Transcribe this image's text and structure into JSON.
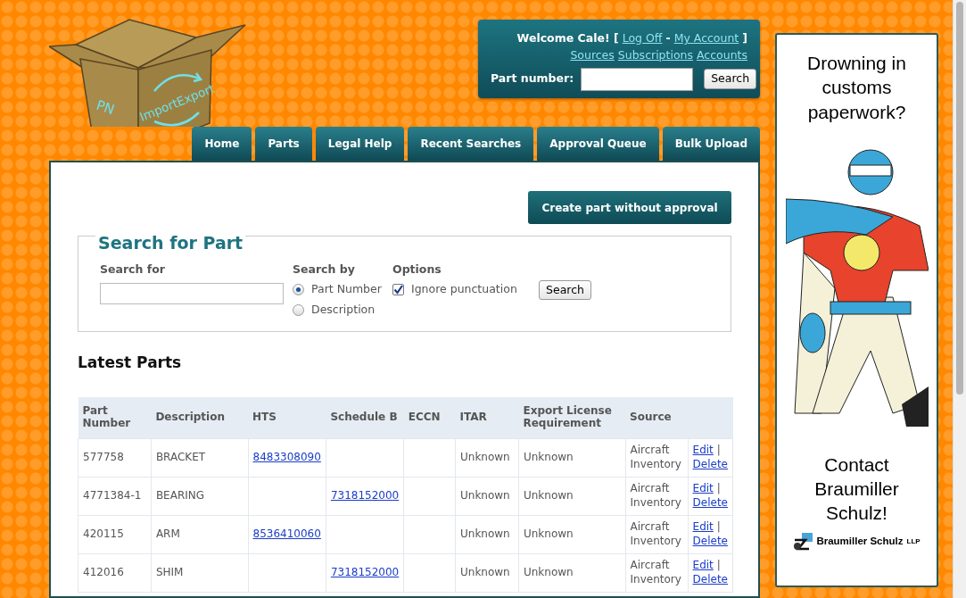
{
  "logo": {
    "letters": "PN",
    "wordmark": "ImportExport"
  },
  "account": {
    "line1": [
      {
        "kind": "text",
        "text": "Welcome Cale! ["
      },
      {
        "kind": "link",
        "text": "Log Off"
      },
      {
        "kind": "text",
        "text": "-"
      },
      {
        "kind": "link",
        "text": "My Account"
      },
      {
        "kind": "text",
        "text": "]"
      }
    ],
    "links": [
      "Sources",
      "Subscriptions",
      "Accounts"
    ],
    "search_label": "Part number:",
    "search_button": "Search"
  },
  "tabs": [
    {
      "label": "Home",
      "selected": false
    },
    {
      "label": "Parts",
      "selected": false
    },
    {
      "label": "Legal Help",
      "selected": false
    },
    {
      "label": "Recent Searches",
      "selected": false
    },
    {
      "label": "Approval Queue",
      "selected": false
    },
    {
      "label": "Bulk Upload",
      "selected": false
    }
  ],
  "create_button": "Create part without approval",
  "search": {
    "legend": "Search for Part",
    "search_for_label": "Search for",
    "search_by_label": "Search by",
    "search_by": [
      {
        "label": "Part Number",
        "selected": true
      },
      {
        "label": "Description",
        "selected": false
      }
    ],
    "options_label": "Options",
    "option": {
      "label": "Ignore punctuation",
      "checked": true
    },
    "button": "Search"
  },
  "latest": {
    "title": "Latest Parts",
    "columns": [
      "Part Number",
      "Description",
      "HTS",
      "Schedule B",
      "ECCN",
      "ITAR",
      "Export License Requirement",
      "Source"
    ],
    "rows": [
      {
        "part_number": "577758",
        "description": "BRACKET",
        "hts": "8483308090",
        "itar": "Unknown",
        "export_license": "Unknown",
        "source": "Aircraft Inventory",
        "edit": "Edit",
        "separator": "|",
        "delete": "Delete"
      },
      {
        "part_number": "4771384-1",
        "description": "BEARING",
        "schedule_b": "7318152000",
        "itar": "Unknown",
        "export_license": "Unknown",
        "source": "Aircraft Inventory",
        "edit": "Edit",
        "separator": "|",
        "delete": "Delete"
      },
      {
        "part_number": "420115",
        "description": "ARM",
        "hts": "8536410060",
        "itar": "Unknown",
        "export_license": "Unknown",
        "source": "Aircraft Inventory",
        "edit": "Edit",
        "separator": "|",
        "delete": "Delete"
      },
      {
        "part_number": "412016",
        "description": "SHIM",
        "schedule_b": "7318152000",
        "itar": "Unknown",
        "export_license": "Unknown",
        "source": "Aircraft Inventory",
        "edit": "Edit",
        "separator": "|",
        "delete": "Delete"
      }
    ]
  },
  "ad": {
    "headline": "Drowning in customs paperwork?",
    "contact": "Contact Braumiller Schulz!",
    "brand": "Braumiller Schulz",
    "brand_suffix": "LLP"
  }
}
